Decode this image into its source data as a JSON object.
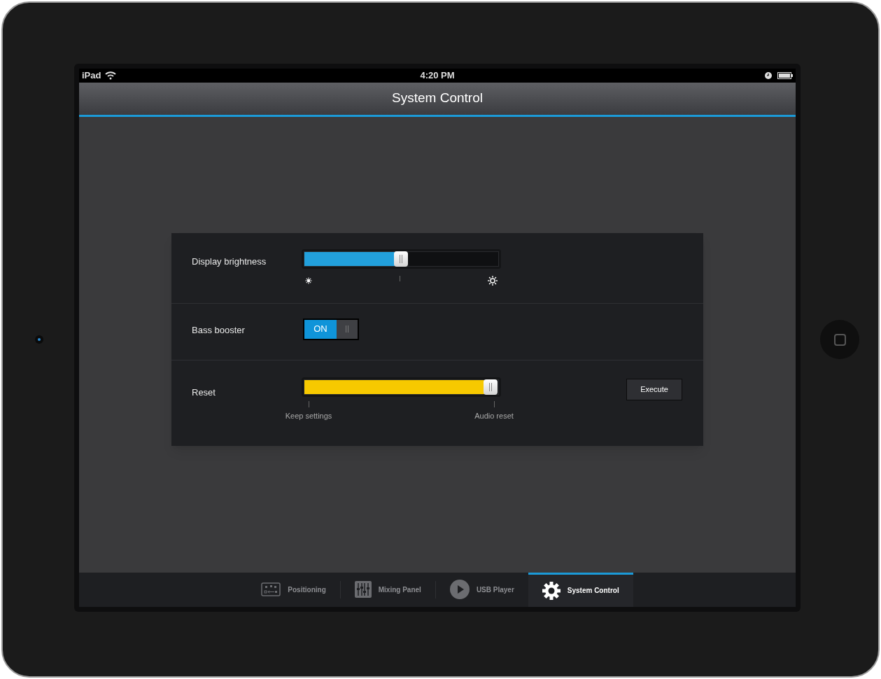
{
  "status_bar": {
    "carrier": "iPad",
    "time": "4:20 PM"
  },
  "nav_bar": {
    "title": "System Control"
  },
  "settings": [
    {
      "kind": "slider",
      "label": "Display brightness",
      "level": 0.5,
      "color": "#22a0dc"
    },
    {
      "kind": "toggle",
      "label": "Bass booster",
      "on": true,
      "on_text": "ON"
    },
    {
      "kind": "reset",
      "label": "Reset",
      "level": 1,
      "color": "#f7c900",
      "scale_labels": [
        "Keep settings",
        "Audio reset"
      ],
      "button": "Execute"
    }
  ],
  "tab_bar": [
    {
      "label": "Positioning",
      "kind": "positioning",
      "selected": false
    },
    {
      "label": "Mixing Panel",
      "kind": "mixer",
      "selected": false
    },
    {
      "label": "USB Player",
      "kind": "player",
      "selected": false
    },
    {
      "label": "System Control",
      "kind": "settings",
      "selected": true
    }
  ]
}
